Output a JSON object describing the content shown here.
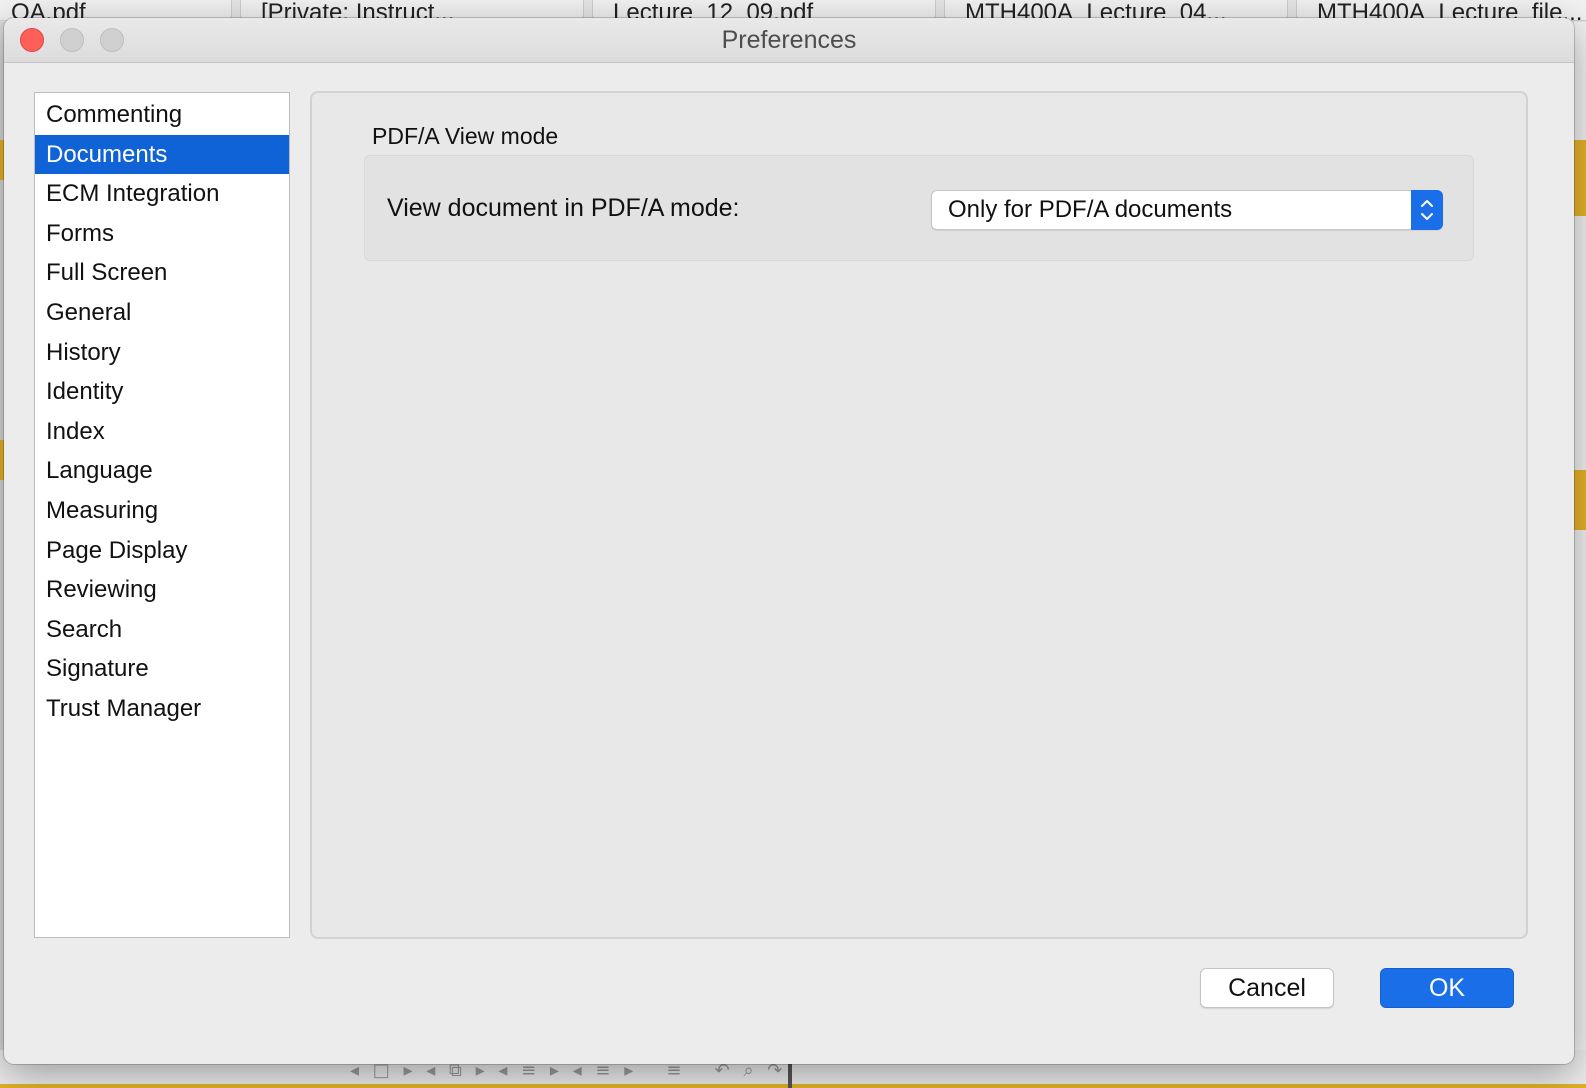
{
  "background": {
    "tabs": [
      {
        "label": "QA.pdf"
      },
      {
        "label": "[Private: Instruct..."
      },
      {
        "label": "Lecture_12_09.pdf"
      },
      {
        "label": "MTH400A_Lecture_04..."
      },
      {
        "label": "MTH400A_Lecture_file..."
      }
    ]
  },
  "dialog": {
    "title": "Preferences"
  },
  "categories": {
    "items": [
      {
        "label": "Commenting",
        "selected": false
      },
      {
        "label": "Documents",
        "selected": true
      },
      {
        "label": "ECM Integration",
        "selected": false
      },
      {
        "label": "Forms",
        "selected": false
      },
      {
        "label": "Full Screen",
        "selected": false
      },
      {
        "label": "General",
        "selected": false
      },
      {
        "label": "History",
        "selected": false
      },
      {
        "label": "Identity",
        "selected": false
      },
      {
        "label": "Index",
        "selected": false
      },
      {
        "label": "Language",
        "selected": false
      },
      {
        "label": "Measuring",
        "selected": false
      },
      {
        "label": "Page Display",
        "selected": false
      },
      {
        "label": "Reviewing",
        "selected": false
      },
      {
        "label": "Search",
        "selected": false
      },
      {
        "label": "Signature",
        "selected": false
      },
      {
        "label": "Trust Manager",
        "selected": false
      }
    ]
  },
  "content": {
    "section_title": "PDF/A View mode",
    "field_label": "View document in PDF/A mode:",
    "select_value": "Only for PDF/A documents"
  },
  "buttons": {
    "cancel": "Cancel",
    "ok": "OK"
  },
  "colors": {
    "selection": "#0f63d6",
    "accent": "#1a6ee8",
    "close": "#fe5f57"
  }
}
